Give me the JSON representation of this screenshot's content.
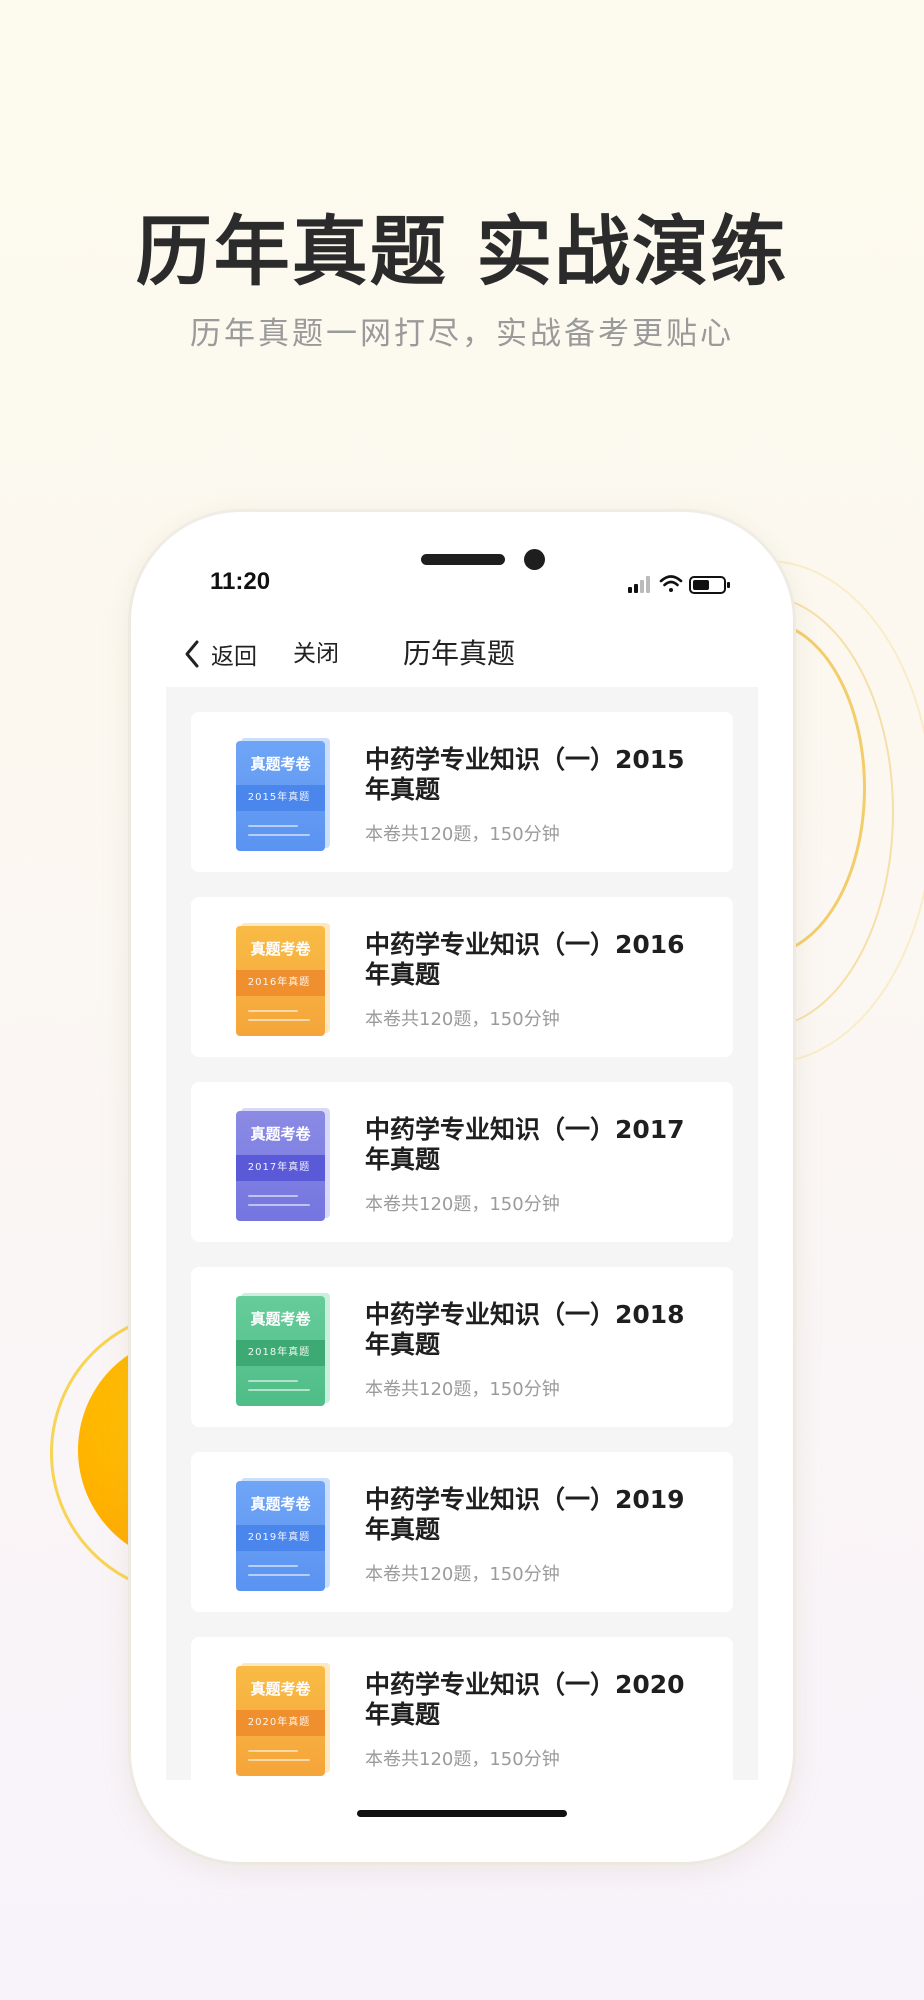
{
  "promo": {
    "headline": "历年真题 实战演练",
    "subline": "历年真题一网打尽，实战备考更贴心"
  },
  "status_bar": {
    "time": "11:20",
    "icons": [
      "signal-icon",
      "wifi-icon",
      "battery-icon"
    ]
  },
  "nav": {
    "back_label": "返回",
    "close_label": "关闭",
    "title": "历年真题"
  },
  "exams": [
    {
      "cover_title": "真题考卷",
      "cover_year": "2015年真题",
      "title": "中药学专业知识（一）2015年真题",
      "meta": "本卷共120题，150分钟",
      "color": "blue"
    },
    {
      "cover_title": "真题考卷",
      "cover_year": "2016年真题",
      "title": "中药学专业知识（一）2016年真题",
      "meta": "本卷共120题，150分钟",
      "color": "orange"
    },
    {
      "cover_title": "真题考卷",
      "cover_year": "2017年真题",
      "title": "中药学专业知识（一）2017年真题",
      "meta": "本卷共120题，150分钟",
      "color": "purple"
    },
    {
      "cover_title": "真题考卷",
      "cover_year": "2018年真题",
      "title": "中药学专业知识（一）2018年真题",
      "meta": "本卷共120题，150分钟",
      "color": "green"
    },
    {
      "cover_title": "真题考卷",
      "cover_year": "2019年真题",
      "title": "中药学专业知识（一）2019年真题",
      "meta": "本卷共120题，150分钟",
      "color": "blue"
    },
    {
      "cover_title": "真题考卷",
      "cover_year": "2020年真题",
      "title": "中药学专业知识（一）2020年真题",
      "meta": "本卷共120题，150分钟",
      "color": "orange"
    }
  ],
  "colors": {
    "blue": "#5a93f1",
    "orange": "#f5a53a",
    "purple": "#7475df",
    "green": "#4fbd87",
    "accent_yellow": "#ffb400"
  }
}
